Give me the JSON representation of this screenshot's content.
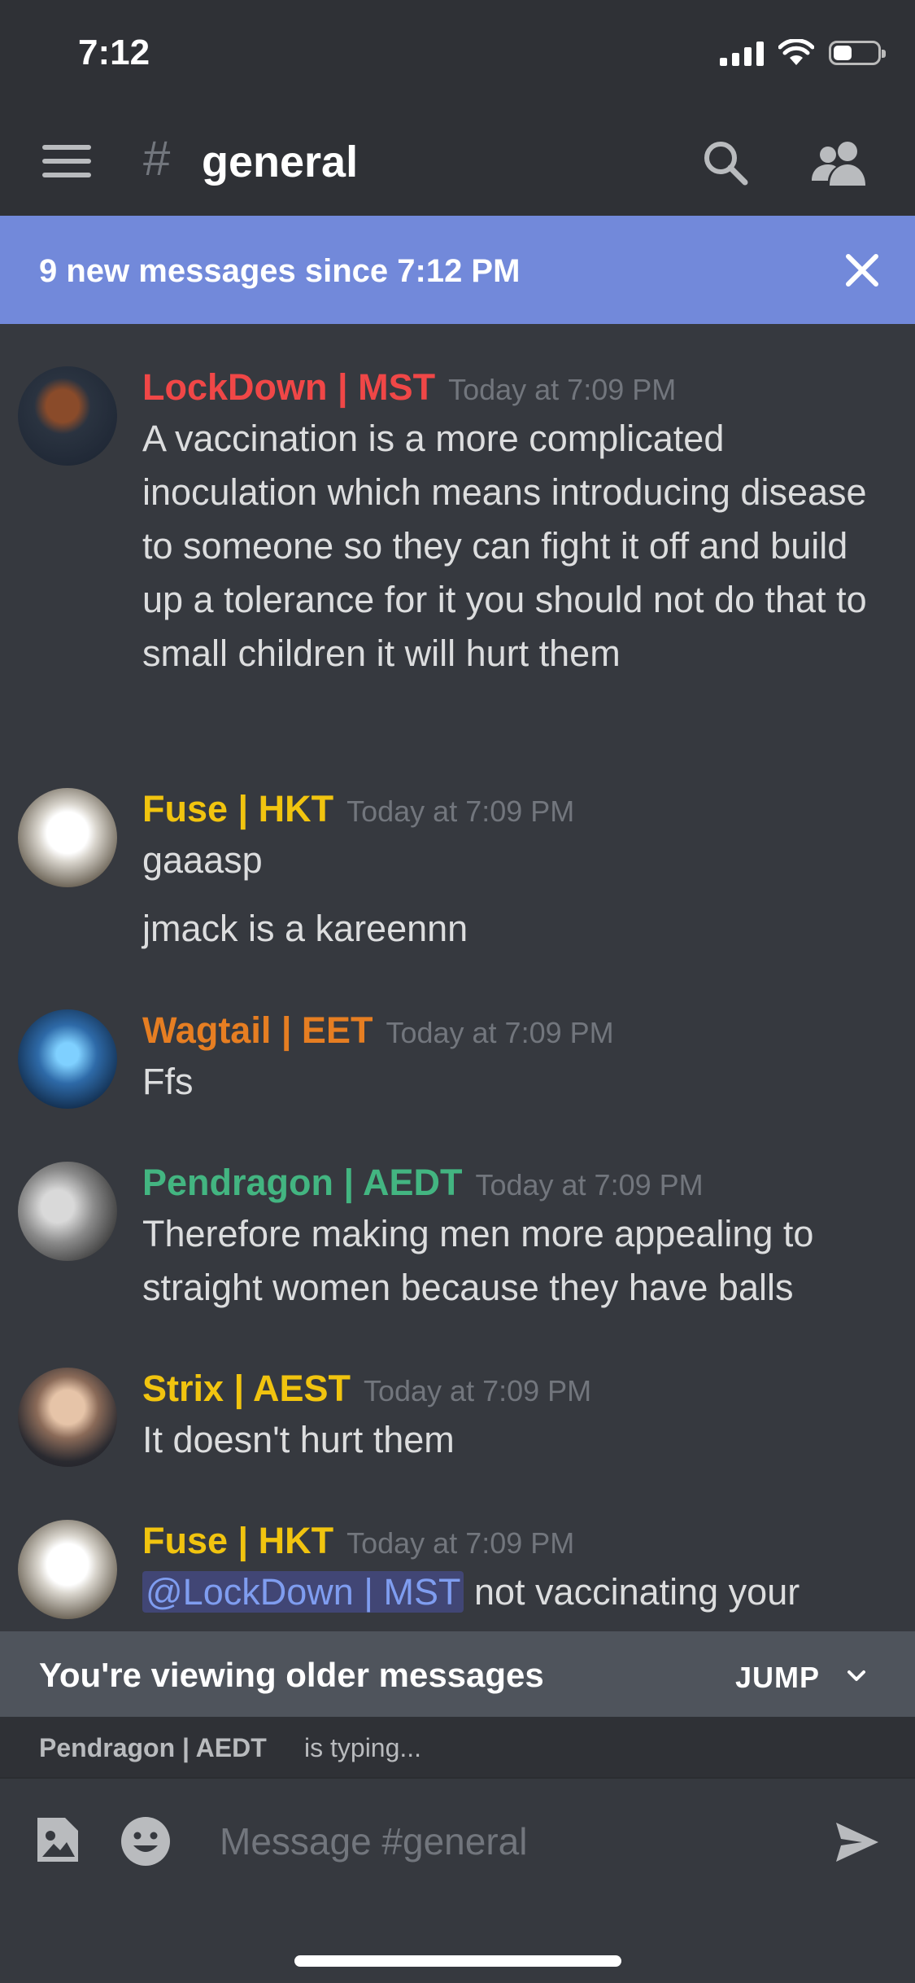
{
  "status_bar": {
    "time": "7:12"
  },
  "header": {
    "hash": "#",
    "channel": "general"
  },
  "banner": {
    "text": "9 new messages since 7:12 PM"
  },
  "messages": [
    {
      "author": "LockDown | MST",
      "author_color": "#f04747",
      "time": "Today at 7:09 PM",
      "lines": [
        "A vaccination is a more complicated inoculation which means introducing disease to someone so they can fight it off and build up a tolerance for it you should not do that to small children it will hurt them"
      ]
    },
    {
      "author": "Fuse | HKT",
      "author_color": "#f1c40f",
      "time": "Today at 7:09 PM",
      "lines": [
        "gaaasp",
        "jmack is a kareennn"
      ]
    },
    {
      "author": "Wagtail | EET",
      "author_color": "#e67e22",
      "time": "Today at 7:09 PM",
      "lines": [
        "Ffs"
      ]
    },
    {
      "author": "Pendragon | AEDT",
      "author_color": "#43b581",
      "time": "Today at 7:09 PM",
      "lines": [
        "Therefore making men more appealing to straight women because they have balls"
      ]
    },
    {
      "author": "Strix | AEST",
      "author_color": "#f1c40f",
      "time": "Today at 7:09 PM",
      "lines": [
        "It doesn't hurt them"
      ]
    },
    {
      "author": "Fuse | HKT",
      "author_color": "#f1c40f",
      "time": "Today at 7:09 PM",
      "mention": "@LockDown | MST",
      "lines": [
        "not vaccinating your"
      ]
    }
  ],
  "older_bar": {
    "text": "You're viewing older messages",
    "jump": "JUMP"
  },
  "typing": {
    "name": "Pendragon | AEDT",
    "suffix": "is typing..."
  },
  "composer": {
    "placeholder": "Message #general"
  },
  "colors": {
    "accent": "#7289da",
    "background": "#36393f",
    "header": "#2f3136"
  }
}
